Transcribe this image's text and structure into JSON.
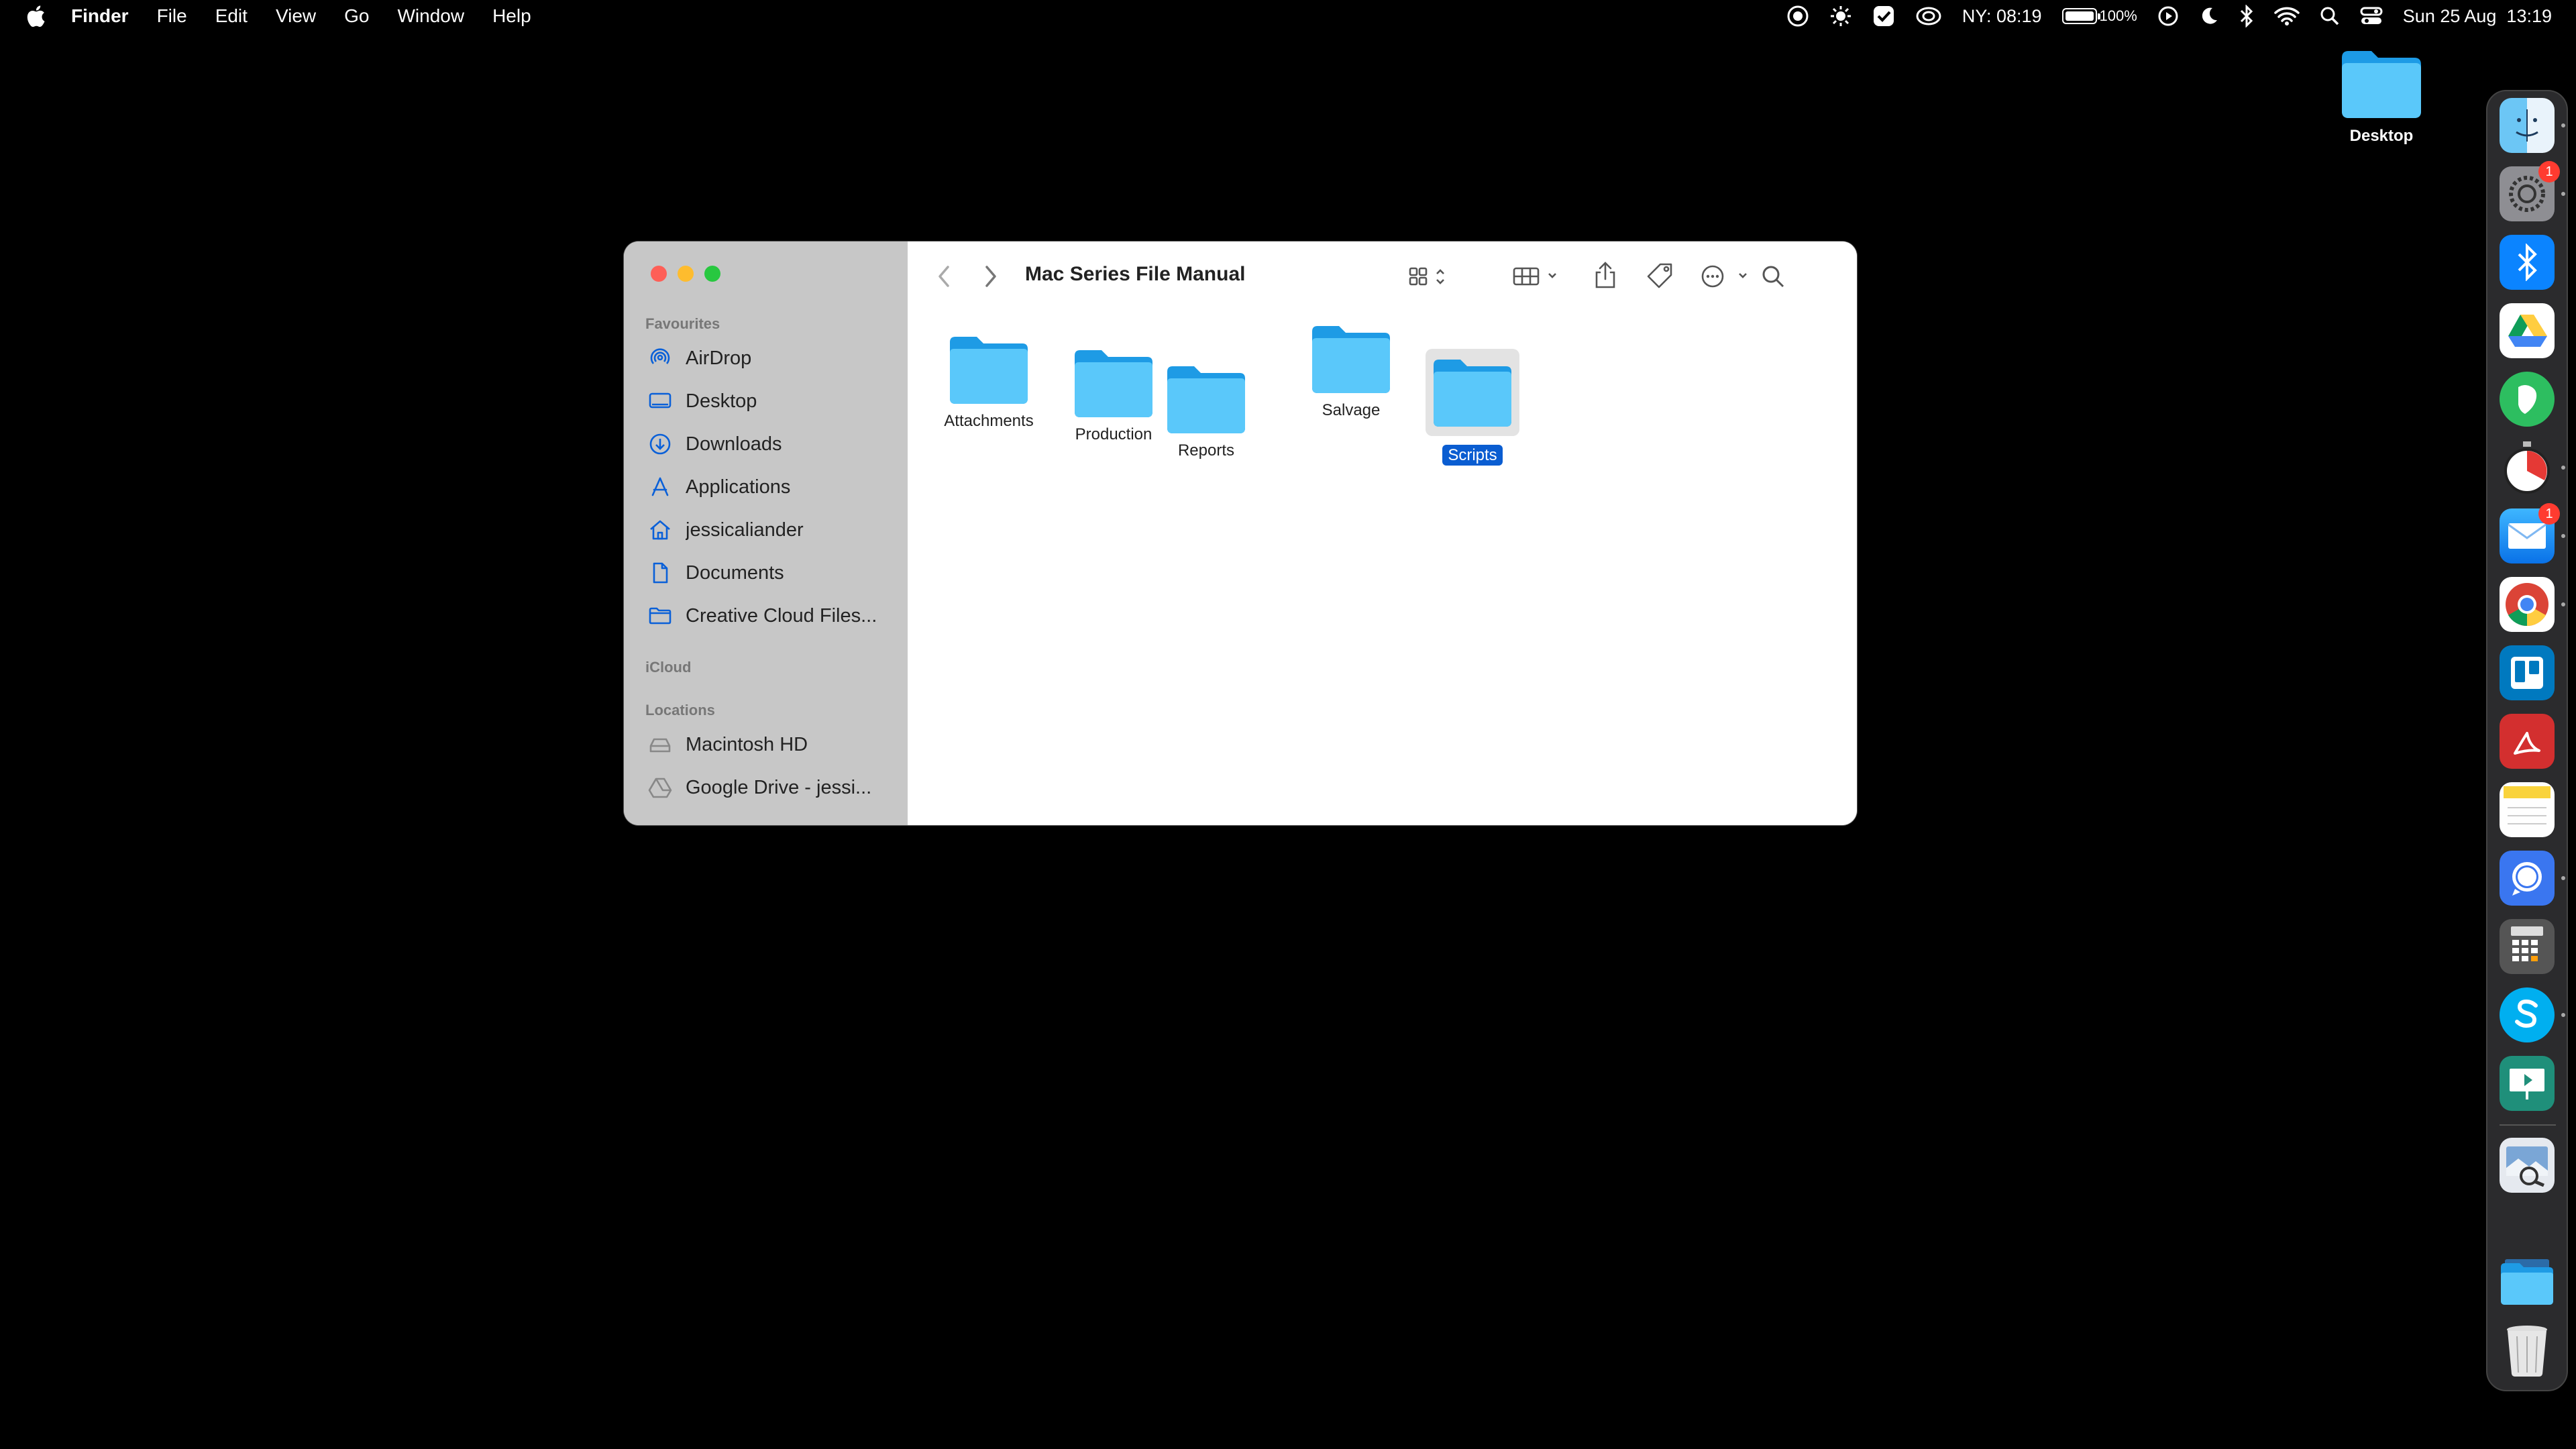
{
  "menubar": {
    "app_name": "Finder",
    "menus": [
      "File",
      "Edit",
      "View",
      "Go",
      "Window",
      "Help"
    ],
    "status": {
      "clock_city": "NY: 08:19",
      "battery_level": "100%",
      "battery_fraction": 1.0,
      "datetime": "Sun 25 Aug  13:19"
    }
  },
  "desktop": {
    "icon_label": "Desktop"
  },
  "finder": {
    "title": "Mac Series File Manual",
    "sidebar": {
      "favourites_header": "Favourites",
      "favourites": [
        {
          "label": "AirDrop",
          "icon": "airdrop-icon"
        },
        {
          "label": "Desktop",
          "icon": "desktop-icon"
        },
        {
          "label": "Downloads",
          "icon": "downloads-icon"
        },
        {
          "label": "Applications",
          "icon": "applications-icon"
        },
        {
          "label": "jessicaliander",
          "icon": "home-icon"
        },
        {
          "label": "Documents",
          "icon": "document-icon"
        },
        {
          "label": "Creative Cloud Files...",
          "icon": "folder-icon"
        }
      ],
      "icloud_header": "iCloud",
      "locations_header": "Locations",
      "locations": [
        {
          "label": "Macintosh HD",
          "icon": "drive-icon"
        },
        {
          "label": "Google Drive - jessi...",
          "icon": "google-drive-icon"
        }
      ]
    },
    "folders": [
      {
        "name": "Attachments",
        "selected": false
      },
      {
        "name": "Production",
        "selected": false
      },
      {
        "name": "Reports",
        "selected": false
      },
      {
        "name": "Salvage",
        "selected": false
      },
      {
        "name": "Scripts",
        "selected": true
      }
    ]
  },
  "dock": {
    "apps": [
      {
        "name": "Finder",
        "icon": "finder-icon"
      },
      {
        "name": "System Settings",
        "icon": "settings-icon",
        "badge": "1"
      },
      {
        "name": "Bluetooth",
        "icon": "bluetooth-icon"
      },
      {
        "name": "Google Drive",
        "icon": "google-drive-icon"
      },
      {
        "name": "Evernote",
        "icon": "evernote-icon"
      },
      {
        "name": "Timer",
        "icon": "timer-icon"
      },
      {
        "name": "Mail",
        "icon": "mail-icon",
        "badge": "1"
      },
      {
        "name": "Chrome",
        "icon": "chrome-icon"
      },
      {
        "name": "Trello",
        "icon": "trello-icon"
      },
      {
        "name": "Acrobat",
        "icon": "acrobat-icon"
      },
      {
        "name": "Notes",
        "icon": "notes-icon"
      },
      {
        "name": "Signal",
        "icon": "signal-icon"
      },
      {
        "name": "Calculator",
        "icon": "calculator-icon"
      },
      {
        "name": "Skype",
        "icon": "skype-icon"
      },
      {
        "name": "Presentation",
        "icon": "presentation-icon"
      },
      {
        "name": "Preview",
        "icon": "preview-icon"
      },
      {
        "name": "Downloads Stack",
        "icon": "folder-icon"
      },
      {
        "name": "Trash",
        "icon": "trash-icon"
      }
    ]
  }
}
